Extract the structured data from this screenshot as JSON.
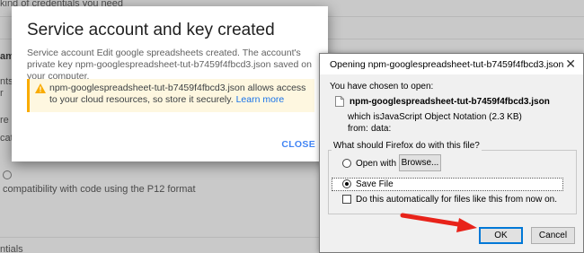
{
  "background": {
    "lines": [
      "kind of credentials you need",
      "ame",
      "nts",
      "r",
      "re",
      "cat",
      "compatibility with code using the P12 format",
      "ntials"
    ]
  },
  "google_dialog": {
    "title": "Service account and key created",
    "body": "Service account Edit google spreadsheets created. The account's private key npm-googlespreadsheet-tut-b7459f4fbcd3.json saved on your computer.",
    "warning_text": "npm-googlespreadsheet-tut-b7459f4fbcd3.json allows access to your cloud resources, so store it securely.",
    "warning_link": "Learn more",
    "warning_icon": "warning-icon",
    "close_label": "CLOSE",
    "accent_color": "#4285f4",
    "warning_color": "#f9ab00"
  },
  "download_dialog": {
    "title": "Opening npm-googlespreadsheet-tut-b7459f4fbcd3.json",
    "close_glyph": "✕",
    "intro": "You have chosen to open:",
    "file_icon": "file-icon",
    "file_name": "npm-googlespreadsheet-tut-b7459f4fbcd3.json",
    "which_is_label": "which is:",
    "which_is_value": "JavaScript Object Notation (2.3 KB)",
    "from_label": "from:",
    "from_value": "data:",
    "question": "What should Firefox do with this file?",
    "open_with_label": "Open with",
    "browse_label": "Browse...",
    "save_file_label": "Save File",
    "selected_option": "Save File",
    "auto_label": "Do this automatically for files like this from now on.",
    "auto_checked": false,
    "ok_label": "OK",
    "cancel_label": "Cancel"
  },
  "annotation": {
    "arrow_color": "#e8231a",
    "arrow_target": "ok-button"
  }
}
